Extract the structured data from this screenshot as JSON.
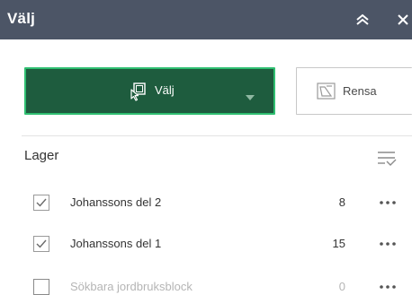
{
  "panel": {
    "title": "Välj",
    "collapse_icon": "double-chevron-up-icon",
    "close_icon": "close-icon"
  },
  "toolbar": {
    "select_label": "Välj",
    "select_icon": "select-by-rectangle-icon",
    "select_caret_icon": "caret-down-icon",
    "clear_label": "Rensa",
    "clear_icon": "clear-selection-icon",
    "accent_color": "#1e5c3e",
    "accent_border": "#2fbf71"
  },
  "layers": {
    "title": "Lager",
    "filter_icon": "filter-list-icon",
    "items": [
      {
        "name": "Johanssons del 2",
        "count": "8",
        "checked": true,
        "enabled": true
      },
      {
        "name": "Johanssons del 1",
        "count": "15",
        "checked": true,
        "enabled": true
      },
      {
        "name": "Sökbara jordbruksblock",
        "count": "0",
        "checked": false,
        "enabled": false
      }
    ],
    "more_icon": "more-horizontal-icon"
  }
}
